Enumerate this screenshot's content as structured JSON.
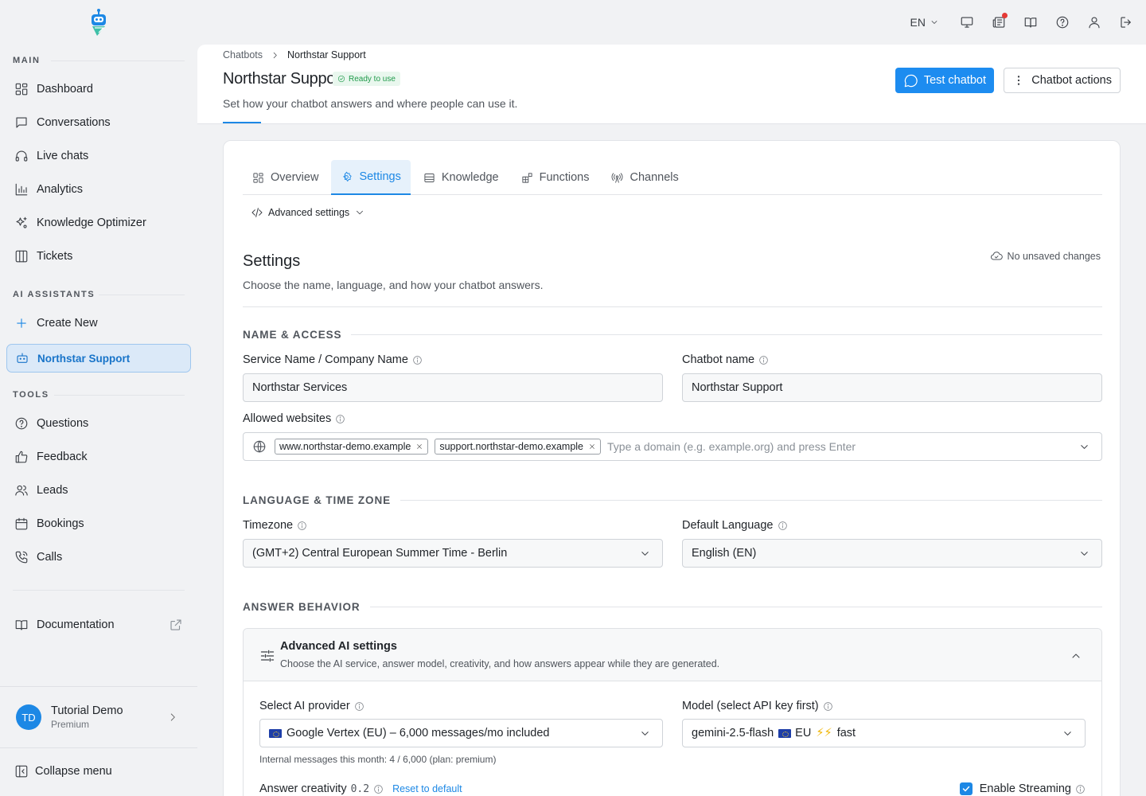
{
  "sidebar": {
    "sections": {
      "main": "MAIN",
      "ai": "AI ASSISTANTS",
      "tools": "TOOLS"
    },
    "main_items": [
      {
        "label": "Dashboard",
        "icon": "dashboard-icon"
      },
      {
        "label": "Conversations",
        "icon": "chat-icon"
      },
      {
        "label": "Live chats",
        "icon": "headset-icon"
      },
      {
        "label": "Analytics",
        "icon": "bar-chart-icon"
      },
      {
        "label": "Knowledge Optimizer",
        "icon": "sparkles-icon"
      },
      {
        "label": "Tickets",
        "icon": "columns-icon"
      }
    ],
    "create_new": "Create New",
    "active_bot": "Northstar Support",
    "tools_items": [
      {
        "label": "Questions",
        "icon": "question-icon"
      },
      {
        "label": "Feedback",
        "icon": "thumbs-up-icon"
      },
      {
        "label": "Leads",
        "icon": "users-icon"
      },
      {
        "label": "Bookings",
        "icon": "calendar-icon"
      },
      {
        "label": "Calls",
        "icon": "phone-icon"
      }
    ],
    "documentation": "Documentation",
    "user": {
      "initials": "TD",
      "name": "Tutorial Demo",
      "plan": "Premium"
    },
    "collapse": "Collapse menu"
  },
  "topbar": {
    "language": "EN"
  },
  "header": {
    "breadcrumb_root": "Chatbots",
    "breadcrumb_current": "Northstar Support",
    "title": "Northstar Support",
    "status": "Ready to use",
    "subtitle": "Set how your chatbot answers and where people can use it.",
    "test_button": "Test chatbot",
    "actions_button": "Chatbot actions"
  },
  "tabs": [
    {
      "label": "Overview",
      "icon": "grid-icon"
    },
    {
      "label": "Settings",
      "icon": "gear-icon"
    },
    {
      "label": "Knowledge",
      "icon": "database-icon"
    },
    {
      "label": "Functions",
      "icon": "blocks-icon"
    },
    {
      "label": "Channels",
      "icon": "broadcast-icon"
    }
  ],
  "advanced_toggle": "Advanced settings",
  "settings": {
    "title": "Settings",
    "subtitle": "Choose the name, language, and how your chatbot answers.",
    "save_status": "No unsaved changes"
  },
  "name_access": {
    "heading": "NAME & ACCESS",
    "service_label": "Service Name / Company Name",
    "service_value": "Northstar Services",
    "chatbot_label": "Chatbot name",
    "chatbot_value": "Northstar Support",
    "websites_label": "Allowed websites",
    "websites": [
      "www.northstar-demo.example",
      "support.northstar-demo.example"
    ],
    "websites_placeholder": "Type a domain (e.g. example.org) and press Enter"
  },
  "language_time": {
    "heading": "LANGUAGE & TIME ZONE",
    "timezone_label": "Timezone",
    "timezone_value": "(GMT+2) Central European Summer Time - Berlin",
    "language_label": "Default Language",
    "language_value": "English (EN)"
  },
  "answer_behavior": {
    "heading": "ANSWER BEHAVIOR",
    "adv_title": "Advanced AI settings",
    "adv_sub": "Choose the AI service, answer model, creativity, and how answers appear while they are generated.",
    "provider_label": "Select AI provider",
    "provider_value": "Google Vertex (EU) – 6,000 messages/mo included",
    "model_label": "Model (select API key first)",
    "model_name": "gemini-2.5-flash",
    "model_region": "EU",
    "model_speed": "⚡⚡",
    "model_tag": "fast",
    "usage_hint": "Internal messages this month: 4 / 6,000 (plan: premium)",
    "creativity_label": "Answer creativity",
    "creativity_value": "0.2",
    "reset_label": "Reset to default",
    "streaming_label": "Enable Streaming",
    "streaming_enabled": true
  },
  "colors": {
    "accent": "#1d88e5",
    "ready": "#1f9a4a",
    "notification": "#e53935"
  }
}
